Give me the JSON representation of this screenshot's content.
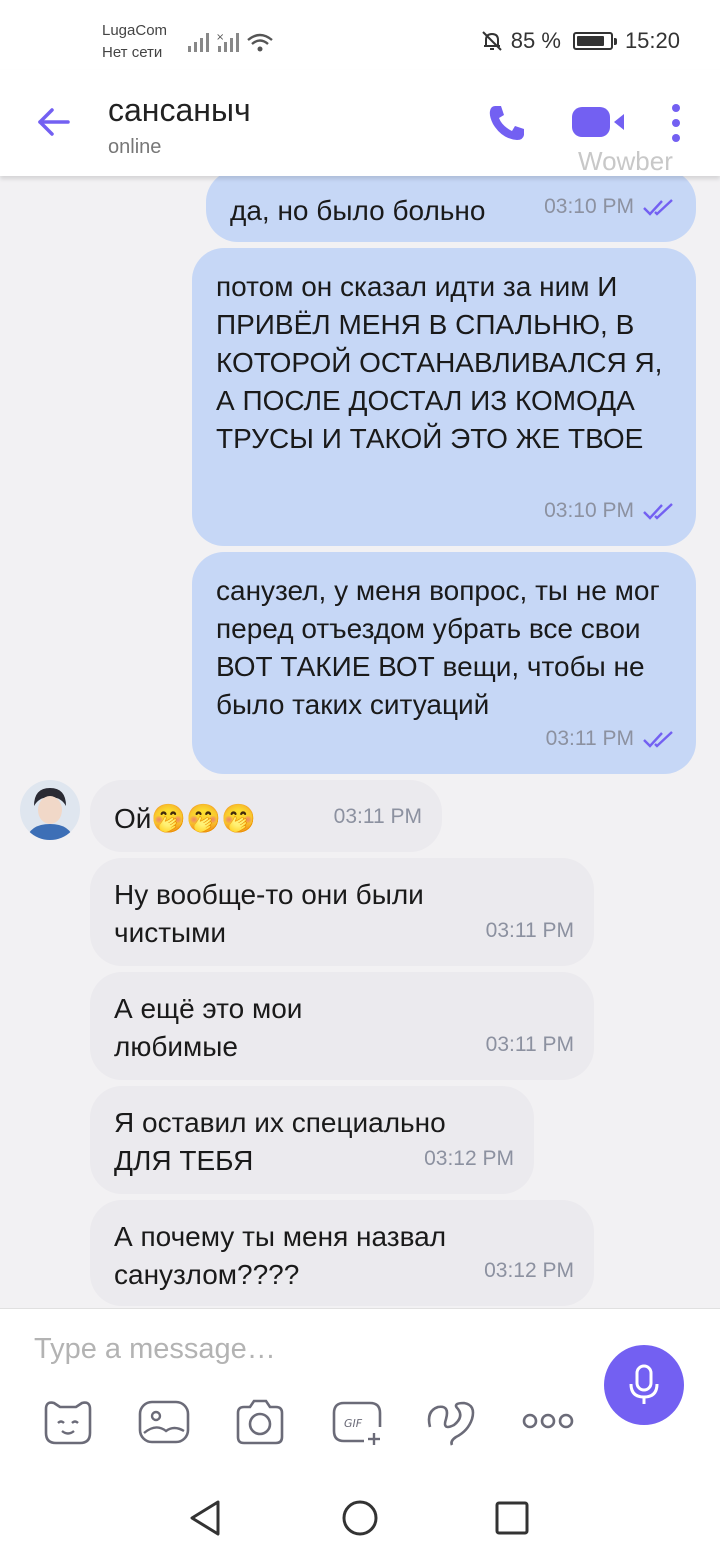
{
  "status_bar": {
    "carrier_name": "LugaCom",
    "carrier_status": "Нет сети",
    "battery_percent": "85 %",
    "battery_level": 0.85,
    "time": "15:20"
  },
  "header": {
    "contact_name": "сансаныч",
    "contact_status": "online",
    "watermark": "Wowber"
  },
  "messages": [
    {
      "direction": "out",
      "text": "да, но было больно",
      "time": "03:10 PM",
      "status_icon": "double-check-icon"
    },
    {
      "direction": "out",
      "text": "потом он сказал идти за ним И ПРИВЁЛ МЕНЯ В СПАЛЬНЮ, В КОТОРОЙ ОСТАНАВЛИВАЛСЯ Я, А ПОСЛЕ ДОСТАЛ ИЗ КОМОДА ТРУСЫ И ТАКОЙ ЭТО ЖЕ ТВОЕ",
      "time": "03:10 PM",
      "status_icon": "double-check-icon"
    },
    {
      "direction": "out",
      "text": "санузел, у меня вопрос, ты не мог перед отъездом убрать все свои ВОТ ТАКИЕ ВОТ вещи, чтобы не было таких ситуаций",
      "time": "03:11 PM",
      "status_icon": "double-check-icon"
    },
    {
      "direction": "in",
      "text": "Ой🤭🤭🤭",
      "time": "03:11 PM"
    },
    {
      "direction": "in",
      "text": "Ну вообще-то они были чистыми",
      "time": "03:11 PM"
    },
    {
      "direction": "in",
      "text": "А ещё это мои любимые",
      "time": "03:11 PM"
    },
    {
      "direction": "in",
      "text": "Я оставил их специально ДЛЯ ТЕБЯ",
      "time": "03:12 PM"
    },
    {
      "direction": "in",
      "text": "А почему ты меня назвал санузлом????",
      "time": "03:12 PM"
    }
  ],
  "composer": {
    "placeholder": "Type a message…"
  },
  "colors": {
    "accent": "#7360f2",
    "outgoing_bubble": "#c6d7f6",
    "incoming_bubble": "#ebeaee",
    "background": "#f2f1f3"
  }
}
